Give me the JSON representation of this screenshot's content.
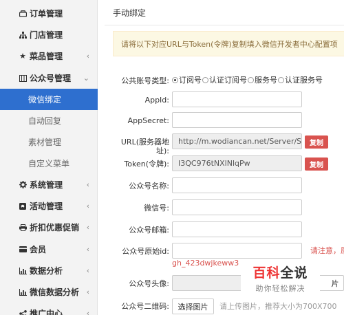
{
  "sidebar": {
    "items": [
      {
        "label": "订单管理",
        "icon": "drive-icon",
        "glyph": "⏏",
        "chevron": false
      },
      {
        "label": "门店管理",
        "icon": "sitemap-icon",
        "glyph": "⊥",
        "chevron": false
      },
      {
        "label": "菜品管理",
        "icon": "star-icon",
        "glyph": "★",
        "chevron": true
      },
      {
        "label": "公众号管理",
        "icon": "columns-icon",
        "glyph": "▥",
        "chevron": true,
        "expanded": true
      },
      {
        "label": "系统管理",
        "icon": "cog-icon",
        "glyph": "✿",
        "chevron": true
      },
      {
        "label": "活动管理",
        "icon": "github-icon",
        "glyph": "◘",
        "chevron": true
      },
      {
        "label": "折扣优惠促销",
        "icon": "print-icon",
        "glyph": "▤",
        "chevron": true
      },
      {
        "label": "会员",
        "icon": "card-icon",
        "glyph": "▬",
        "chevron": true
      },
      {
        "label": "数据分析",
        "icon": "bar-chart-icon",
        "glyph": "▙",
        "chevron": true
      },
      {
        "label": "微信数据分析",
        "icon": "bar-chart-icon",
        "glyph": "▙",
        "chevron": true
      },
      {
        "label": "推广中心",
        "icon": "share-icon",
        "glyph": "✚",
        "chevron": true
      }
    ],
    "subitems": [
      {
        "label": "微信绑定",
        "active": true
      },
      {
        "label": "自动回复"
      },
      {
        "label": "素材管理"
      },
      {
        "label": "自定义菜单"
      }
    ]
  },
  "main": {
    "title": "手动绑定",
    "notice": "请将以下对应URL与Token(令牌)复制填入微信开发者中心配置项"
  },
  "form": {
    "account_type": {
      "label": "公共账号类型:",
      "options": [
        "订阅号",
        "认证订阅号",
        "服务号",
        "认证服务号"
      ],
      "selected": 0
    },
    "appid_label": "AppId:",
    "appsecret_label": "AppSecret:",
    "url_label_line1": "URL(服务器地",
    "url_label_line2": "址):",
    "url_value": "http://m.wodiancan.net/Server/Server",
    "copy_label": "复制",
    "token_label": "Token(令牌):",
    "token_value": "I3QC976tNXlNlqPw",
    "name_label": "公众号名称:",
    "wechat_id_label": "微信号:",
    "email_label": "公众号邮箱:",
    "original_id_label": "公众号原始id:",
    "original_id_hint": "请注意，原",
    "original_id_example": "gh_423dwjkeww3",
    "avatar_label": "公众号头像:",
    "avatar_button_partial": "片",
    "qrcode_label": "公众号二维码:",
    "qrcode_button": "选择图片",
    "qrcode_help": "请上传图片，推荐大小为700X700"
  },
  "watermark": {
    "line1_a": "百科",
    "line1_b": "全说",
    "line2": "助你轻松解决"
  }
}
